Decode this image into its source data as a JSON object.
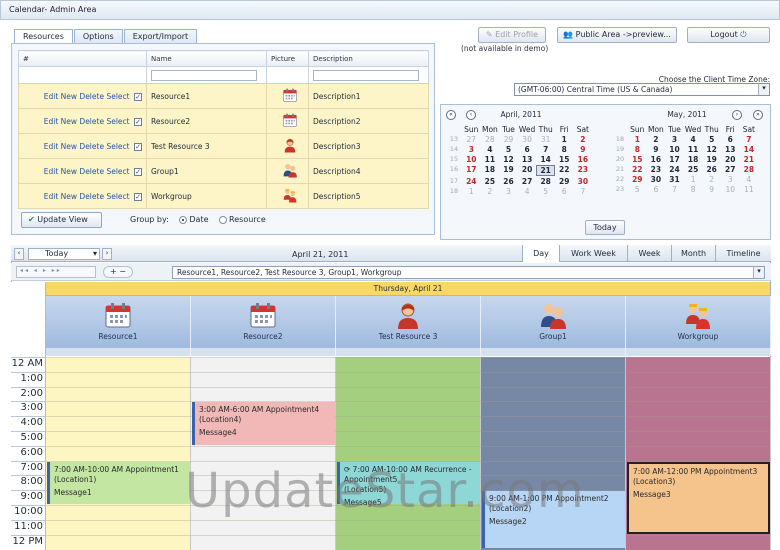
{
  "window": {
    "title": "Calendar- Admin Area"
  },
  "tabs": [
    {
      "label": "Resources"
    },
    {
      "label": "Options"
    },
    {
      "label": "Export/Import"
    }
  ],
  "grid": {
    "columns": [
      "#",
      "Name",
      "Picture",
      "Description"
    ],
    "action_labels": {
      "edit": "Edit",
      "new": "New",
      "delete": "Delete",
      "select": "Select"
    },
    "check_glyph": "✓",
    "rows": [
      {
        "name": "Resource1",
        "description": "Description1",
        "icon": "calendar-icon"
      },
      {
        "name": "Resource2",
        "description": "Description2",
        "icon": "calendar-icon"
      },
      {
        "name": "Test Resource 3",
        "description": "Description3",
        "icon": "person-icon"
      },
      {
        "name": "Group1",
        "description": "Description4",
        "icon": "group-icon"
      },
      {
        "name": "Workgroup",
        "description": "Description5",
        "icon": "workgroup-icon"
      }
    ]
  },
  "footer": {
    "update_label": "Update View",
    "group_by_label": "Group by:",
    "radio_date": "Date",
    "radio_resource": "Resource"
  },
  "top_buttons": {
    "edit_profile": "Edit Profile",
    "edit_profile_note": "(not available in demo)",
    "public_area": "Public Area ->preview...",
    "logout": "Logout"
  },
  "timezone": {
    "label": "Choose the Client Time Zone:",
    "value": "(GMT-06:00) Central Time (US & Canada)"
  },
  "mini_calendars": [
    {
      "title": "April, 2011",
      "weekdays": [
        "Sun",
        "Mon",
        "Tue",
        "Wed",
        "Thu",
        "Fri",
        "Sat"
      ],
      "weeks": [
        {
          "wk": "13",
          "days": [
            "27",
            "28",
            "29",
            "30",
            "31",
            "1",
            "2"
          ],
          "other": [
            0,
            1,
            2,
            3,
            4
          ]
        },
        {
          "wk": "14",
          "days": [
            "3",
            "4",
            "5",
            "6",
            "7",
            "8",
            "9"
          ],
          "other": []
        },
        {
          "wk": "15",
          "days": [
            "10",
            "11",
            "12",
            "13",
            "14",
            "15",
            "16"
          ],
          "other": []
        },
        {
          "wk": "16",
          "days": [
            "17",
            "18",
            "19",
            "20",
            "21",
            "22",
            "23"
          ],
          "other": []
        },
        {
          "wk": "17",
          "days": [
            "24",
            "25",
            "26",
            "27",
            "28",
            "29",
            "30"
          ],
          "other": []
        },
        {
          "wk": "18",
          "days": [
            "1",
            "2",
            "3",
            "4",
            "5",
            "6",
            "7"
          ],
          "other": [
            0,
            1,
            2,
            3,
            4,
            5,
            6
          ]
        }
      ],
      "selected": "21"
    },
    {
      "title": "May, 2011",
      "weekdays": [
        "Sun",
        "Mon",
        "Tue",
        "Wed",
        "Thu",
        "Fri",
        "Sat"
      ],
      "weeks": [
        {
          "wk": "18",
          "days": [
            "1",
            "2",
            "3",
            "4",
            "5",
            "6",
            "7"
          ],
          "other": []
        },
        {
          "wk": "19",
          "days": [
            "8",
            "9",
            "10",
            "11",
            "12",
            "13",
            "14"
          ],
          "other": []
        },
        {
          "wk": "20",
          "days": [
            "15",
            "16",
            "17",
            "18",
            "19",
            "20",
            "21"
          ],
          "other": []
        },
        {
          "wk": "21",
          "days": [
            "22",
            "23",
            "24",
            "25",
            "26",
            "27",
            "28"
          ],
          "other": []
        },
        {
          "wk": "22",
          "days": [
            "29",
            "30",
            "31",
            "1",
            "2",
            "3",
            "4"
          ],
          "other": [
            3,
            4,
            5,
            6
          ]
        },
        {
          "wk": "23",
          "days": [
            "5",
            "6",
            "7",
            "8",
            "9",
            "10",
            "11"
          ],
          "other": [
            0,
            1,
            2,
            3,
            4,
            5,
            6
          ]
        }
      ],
      "selected": ""
    }
  ],
  "today_button": "Today",
  "scheduler": {
    "today_label": "Today",
    "date_label": "April 21, 2011",
    "views": [
      "Day",
      "Work Week",
      "Week",
      "Month",
      "Timeline"
    ],
    "active_view": "Day",
    "pager_glyphs": "◂◂ ◂ ▸ ▸▸",
    "zoom_glyphs": "+ −",
    "resource_filter": "Resource1, Resource2, Test Resource 3, Group1, Workgroup",
    "day_header": "Thursday, April 21",
    "resources": [
      {
        "name": "Resource1",
        "icon": "calendar-icon",
        "color": "#fdf6c3"
      },
      {
        "name": "Resource2",
        "icon": "calendar-icon",
        "color": "#f2f2f2"
      },
      {
        "name": "Test Resource 3",
        "icon": "person-icon",
        "color": "#a4cf7e"
      },
      {
        "name": "Group1",
        "icon": "group-icon",
        "color": "#7688a6"
      },
      {
        "name": "Workgroup",
        "icon": "workgroup-icon",
        "color": "#b9748f"
      }
    ],
    "hours": [
      "12 AM",
      "1:00",
      "2:00",
      "3:00",
      "4:00",
      "5:00",
      "6:00",
      "7:00",
      "8:00",
      "9:00",
      "10:00",
      "11:00",
      "12 PM"
    ],
    "appointments": [
      {
        "title": "3:00 AM-6:00 AM Appointment4",
        "location": "(Location4)",
        "message": "Message4",
        "resource": 1,
        "color": "#f2b8b8"
      },
      {
        "title": "7:00 AM-10:00 AM Appointment1",
        "location": "(Location1)",
        "message": "Message1",
        "resource": 0,
        "color": "#c4e6a3"
      },
      {
        "title": "7:00 AM-10:00 AM Recurrence - Appointment5",
        "location": "(Location5)",
        "message": "Message5",
        "resource": 2,
        "color": "#8ed7d7"
      },
      {
        "title": "9:00 AM-1:00 PM Appointment2",
        "location": "(Location2)",
        "message": "Message2",
        "resource": 3,
        "color": "#b7d6f5"
      },
      {
        "title": "7:00 AM-12:00 PM Appointment3",
        "location": "(Location3)",
        "message": "Message3",
        "resource": 4,
        "color": "#f5c38c"
      }
    ]
  },
  "watermark": "UpdateStar.com"
}
